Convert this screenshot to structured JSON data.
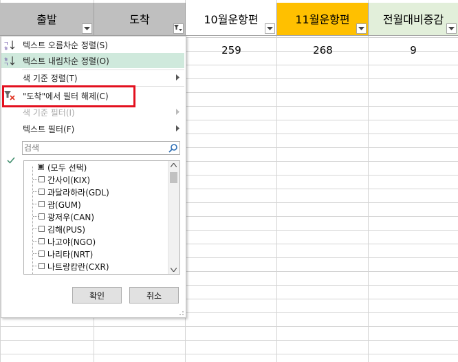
{
  "columns": [
    {
      "header": "출발",
      "filter_active": false
    },
    {
      "header": "도착",
      "filter_active": true
    },
    {
      "header": "10월운항편",
      "filter_active": false
    },
    {
      "header": "11월운항편",
      "filter_active": false,
      "highlight_color": "#ffc000"
    },
    {
      "header": "전월대비증감",
      "filter_active": false,
      "highlight_color": "#e2efda"
    }
  ],
  "row1": {
    "oct": "259",
    "nov": "268",
    "change": "9"
  },
  "menu": {
    "sort_asc": "텍스트 오름차순 정렬(S)",
    "sort_desc": "텍스트 내림차순 정렬(O)",
    "sort_by_color": "색 기준 정렬(T)",
    "clear_filter": "\"도착\"에서 필터 해제(C)",
    "filter_by_color": "색 기준 필터(I)",
    "text_filter": "텍스트 필터(F)",
    "search_placeholder": "검색",
    "items": [
      {
        "label": "(모두 선택)",
        "state": "mixed"
      },
      {
        "label": "간사이(KIX)",
        "state": "unchecked"
      },
      {
        "label": "과달라하라(GDL)",
        "state": "unchecked"
      },
      {
        "label": "괌(GUM)",
        "state": "unchecked"
      },
      {
        "label": "광저우(CAN)",
        "state": "unchecked"
      },
      {
        "label": "김해(PUS)",
        "state": "unchecked"
      },
      {
        "label": "나고야(NGO)",
        "state": "unchecked"
      },
      {
        "label": "나리타(NRT)",
        "state": "unchecked"
      },
      {
        "label": "나트랑캄란(CXR)",
        "state": "unchecked"
      }
    ],
    "ok_label": "확인",
    "cancel_label": "취소"
  },
  "colors": {
    "selected_item": "#cfe9dc",
    "highlight_box": "#e3101e"
  }
}
